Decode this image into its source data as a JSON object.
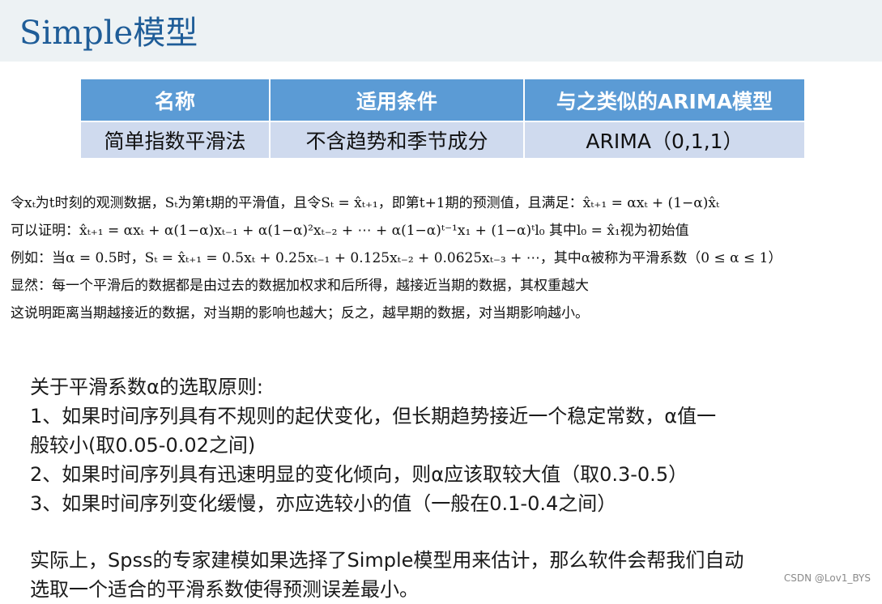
{
  "title": "Simple模型",
  "table": {
    "headers": [
      "名称",
      "适用条件",
      "与之类似的ARIMA模型"
    ],
    "row": [
      "简单指数平滑法",
      "不含趋势和季节成分",
      "ARIMA（0,1,1）"
    ]
  },
  "formulas": [
    "令xₜ为t时刻的观测数据，Sₜ为第t期的平滑值，且令Sₜ = x̂ₜ₊₁，即第t+1期的预测值，且满足：x̂ₜ₊₁ = αxₜ + (1−α)x̂ₜ",
    "可以证明：x̂ₜ₊₁ = αxₜ + α(1−α)xₜ₋₁ + α(1−α)²xₜ₋₂ + ⋯ + α(1−α)ᵗ⁻¹x₁ + (1−α)ᵗl₀  其中l₀ = x̂₁视为初始值",
    "例如：当α = 0.5时，Sₜ = x̂ₜ₊₁ = 0.5xₜ + 0.25xₜ₋₁ + 0.125xₜ₋₂ + 0.0625xₜ₋₃ + ⋯，其中α被称为平滑系数（0 ≤ α ≤ 1）",
    "显然：每一个平滑后的数据都是由过去的数据加权求和后所得，越接近当期的数据，其权重越大",
    "这说明距离当期越接近的数据，对当期的影响也越大；反之，越早期的数据，对当期影响越小。"
  ],
  "rules": {
    "heading": "关于平滑系数α的选取原则:",
    "lines": [
      "1、如果时间序列具有不规则的起伏变化，但长期趋势接近一个稳定常数，α值一",
      "般较小(取0.05-0.02之间)",
      "2、如果时间序列具有迅速明显的变化倾向，则α应该取较大值（取0.3-0.5）",
      "3、如果时间序列变化缓慢，亦应选较小的值（一般在0.1-0.4之间）"
    ],
    "conclusion": [
      "实际上，Spss的专家建模如果选择了Simple模型用来估计，那么软件会帮我们自动",
      "选取一个适合的平滑系数使得预测误差最小。"
    ]
  },
  "watermark": "CSDN @Lov1_BYS"
}
